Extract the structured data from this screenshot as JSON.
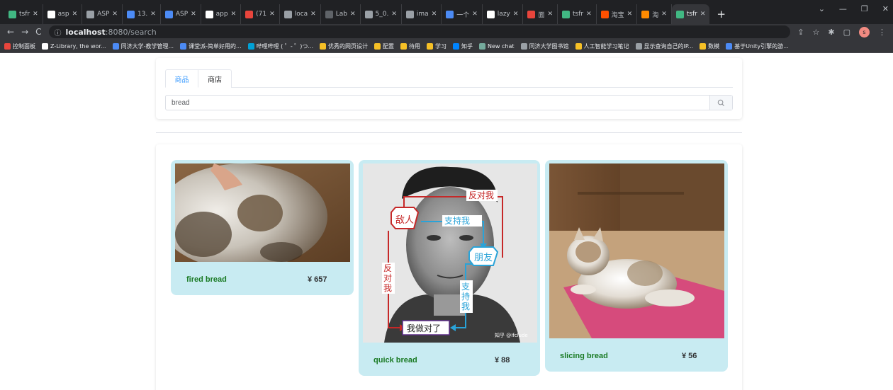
{
  "browser": {
    "tabs": [
      {
        "label": "tsfr",
        "color": "#41b883"
      },
      {
        "label": "asp",
        "color": "#ffffff"
      },
      {
        "label": "ASP",
        "color": "#9aa0a6"
      },
      {
        "label": "13.",
        "color": "#4c8bf5"
      },
      {
        "label": "ASP",
        "color": "#4c8bf5"
      },
      {
        "label": "app",
        "color": "#ffffff"
      },
      {
        "label": "(71",
        "color": "#e8453c"
      },
      {
        "label": "loca",
        "color": "#9aa0a6"
      },
      {
        "label": "Lab",
        "color": "#5f6368"
      },
      {
        "label": "5_0.",
        "color": "#9aa0a6"
      },
      {
        "label": "ima",
        "color": "#9aa0a6"
      },
      {
        "label": "一个",
        "color": "#4c8bf5"
      },
      {
        "label": "lazy",
        "color": "#ffffff"
      },
      {
        "label": "面",
        "color": "#e8453c"
      },
      {
        "label": "tsfr",
        "color": "#41b883"
      },
      {
        "label": "淘宝",
        "color": "#ff5000"
      },
      {
        "label": "淘",
        "color": "#ff8a00"
      },
      {
        "label": "tsfr",
        "color": "#41b883"
      }
    ],
    "url_host": "localhost",
    "url_path": ":8080/search",
    "bookmarks": [
      {
        "label": "控制面板",
        "color": "#e8453c"
      },
      {
        "label": "Z-Library, the wor...",
        "color": "#ffffff"
      },
      {
        "label": "同济大学-教学管理...",
        "color": "#4c8bf5"
      },
      {
        "label": "课堂派-简单好用的...",
        "color": "#4c8bf5"
      },
      {
        "label": "哔哩哔哩 ( ゜- ゜)つ...",
        "color": "#00a1d6"
      },
      {
        "label": "优秀的网页设计",
        "color": "#f6c026"
      },
      {
        "label": "配置",
        "color": "#f6c026"
      },
      {
        "label": "待用",
        "color": "#f6c026"
      },
      {
        "label": "学习",
        "color": "#f6c026"
      },
      {
        "label": "知乎",
        "color": "#0084ff"
      },
      {
        "label": "New chat",
        "color": "#74aa9c"
      },
      {
        "label": "同济大学图书馆",
        "color": "#9aa0a6"
      },
      {
        "label": "人工智能学习笔记",
        "color": "#f6c026"
      },
      {
        "label": "显示查询自己的IP...",
        "color": "#9aa0a6"
      },
      {
        "label": "数模",
        "color": "#f6c026"
      },
      {
        "label": "基于Unity引擎的游...",
        "color": "#4c8bf5"
      }
    ],
    "profile_initial": "s"
  },
  "search": {
    "tabs": [
      "商品",
      "商店"
    ],
    "active_tab": 0,
    "query": "bread"
  },
  "products": [
    {
      "name": "fired bread",
      "price": "¥ 657",
      "image": "cat-photo"
    },
    {
      "name": "quick bread",
      "price": "¥ 88",
      "image": "portrait-meme"
    },
    {
      "name": "slicing bread",
      "price": "¥ 56",
      "image": "cat-on-mat"
    }
  ],
  "meme": {
    "enemy": "敌人",
    "support_me": "支持我",
    "oppose_me_top": "反对我",
    "friend": "朋友",
    "oppose_me_side": "反对我",
    "support_me_side": "支持我",
    "bottom": "我做对了",
    "watermark": "知乎 @Ifclude"
  },
  "colors": {
    "accent": "#409eff",
    "card_bg": "#c8ebf2",
    "product_name": "#1a7a24"
  }
}
